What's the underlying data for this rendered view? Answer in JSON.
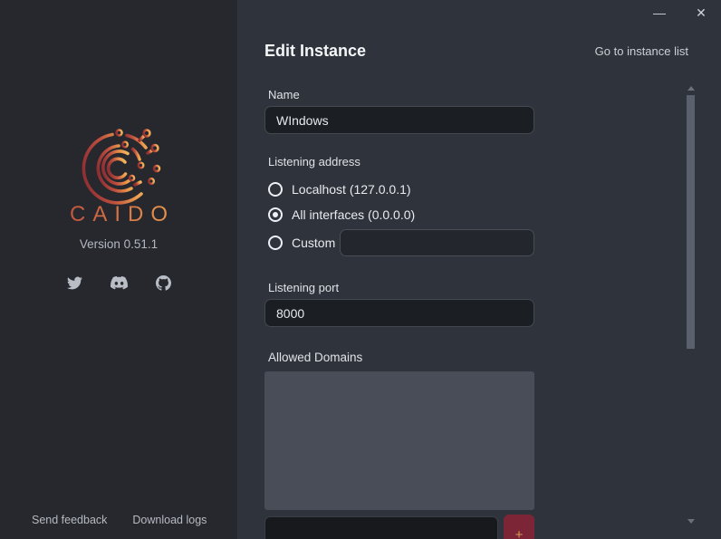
{
  "window": {
    "minimize_glyph": "—",
    "close_glyph": "✕"
  },
  "sidebar": {
    "brand": "CAIDO",
    "version": "Version 0.51.1",
    "social_icons": [
      "twitter-icon",
      "discord-icon",
      "github-icon"
    ],
    "footer": {
      "send_feedback": "Send feedback",
      "download_logs": "Download logs"
    }
  },
  "main": {
    "title": "Edit Instance",
    "go_to_instance_list": "Go to instance list",
    "form": {
      "name_label": "Name",
      "name_value": "WIndows",
      "listening_address_label": "Listening address",
      "radios": [
        {
          "label": "Localhost (127.0.0.1)",
          "selected": false
        },
        {
          "label": "All interfaces (0.0.0.0)",
          "selected": true
        },
        {
          "label": "Custom",
          "selected": false
        }
      ],
      "custom_address_value": "",
      "listening_port_label": "Listening port",
      "listening_port_value": "8000",
      "allowed_domains_label": "Allowed Domains",
      "allowed_domains_items": [],
      "new_domain_value": "",
      "add_domain_glyph": "+"
    }
  },
  "colors": {
    "sidebar_bg": "#26282e",
    "main_bg": "#2f333b",
    "input_bg": "#1b1e23",
    "domains_box_bg": "#484d58",
    "add_button_bg": "#7c2536",
    "logo_gradient_start": "#a33a38",
    "logo_gradient_end": "#efa854",
    "scroll_thumb": "#5a616c"
  }
}
